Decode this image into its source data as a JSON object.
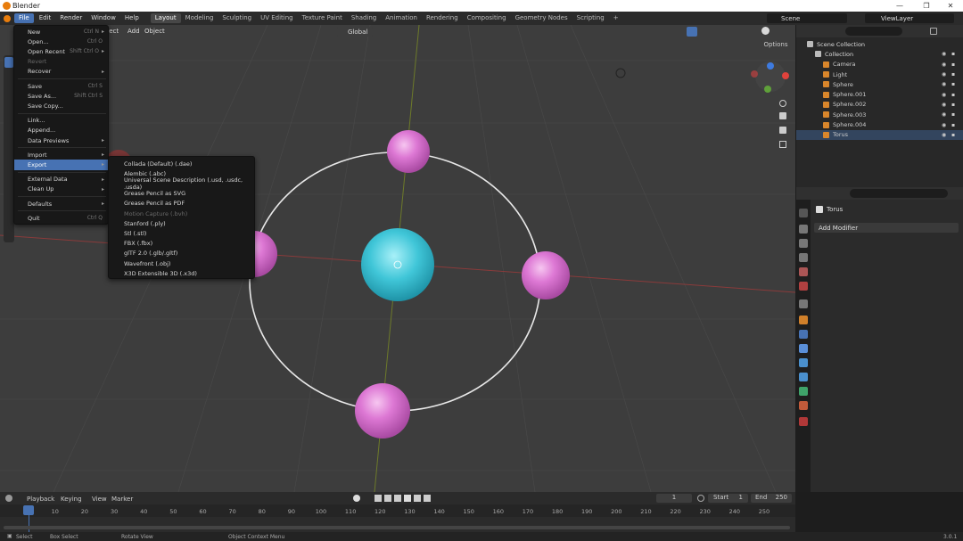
{
  "window": {
    "title": "Blender",
    "controls": [
      "—",
      "❐",
      "✕"
    ]
  },
  "menubar": {
    "items": [
      "File",
      "Edit",
      "Render",
      "Window",
      "Help"
    ],
    "workspaces": [
      "Layout",
      "Modeling",
      "Sculpting",
      "UV Editing",
      "Texture Paint",
      "Shading",
      "Animation",
      "Rendering",
      "Compositing",
      "Geometry Nodes",
      "Scripting"
    ],
    "add_ws": "+",
    "scene": "Scene",
    "view_layer": "ViewLayer"
  },
  "viewport": {
    "header_partial": "elect",
    "add": "Add",
    "object": "Object",
    "orientation": "Global",
    "options": "Options"
  },
  "file_menu": [
    {
      "label": "New",
      "shortcut": "Ctrl N",
      "arrow": true
    },
    {
      "label": "Open...",
      "shortcut": "Ctrl O"
    },
    {
      "label": "Open Recent",
      "shortcut": "Shift Ctrl O",
      "arrow": true
    },
    {
      "label": "Revert",
      "disabled": true
    },
    {
      "label": "Recover",
      "arrow": true
    },
    {
      "sep": true
    },
    {
      "label": "Save",
      "shortcut": "Ctrl S"
    },
    {
      "label": "Save As...",
      "shortcut": "Shift Ctrl S"
    },
    {
      "label": "Save Copy..."
    },
    {
      "sep": true
    },
    {
      "label": "Link..."
    },
    {
      "label": "Append..."
    },
    {
      "label": "Data Previews",
      "arrow": true
    },
    {
      "sep": true
    },
    {
      "label": "Import",
      "arrow": true
    },
    {
      "label": "Export",
      "arrow": true,
      "highlight": true
    },
    {
      "sep": true
    },
    {
      "label": "External Data",
      "arrow": true
    },
    {
      "label": "Clean Up",
      "arrow": true
    },
    {
      "sep": true
    },
    {
      "label": "Defaults",
      "arrow": true
    },
    {
      "sep": true
    },
    {
      "label": "Quit",
      "shortcut": "Ctrl Q"
    }
  ],
  "export_menu": [
    {
      "label": "Collada (Default) (.dae)"
    },
    {
      "label": "Alembic (.abc)"
    },
    {
      "label": "Universal Scene Description (.usd, .usdc, .usda)"
    },
    {
      "label": "Grease Pencil as SVG"
    },
    {
      "label": "Grease Pencil as PDF"
    },
    {
      "label": "Motion Capture (.bvh)",
      "disabled": true
    },
    {
      "label": "Stanford (.ply)"
    },
    {
      "label": "Stl (.stl)"
    },
    {
      "label": "FBX (.fbx)"
    },
    {
      "label": "glTF 2.0 (.glb/.gltf)"
    },
    {
      "label": "Wavefront (.obj)"
    },
    {
      "label": "X3D Extensible 3D (.x3d)"
    }
  ],
  "outliner": {
    "rows": [
      {
        "label": "Scene Collection",
        "indent": 0,
        "color": "#ddd"
      },
      {
        "label": "Collection",
        "indent": 1,
        "color": "#ddd"
      },
      {
        "label": "Camera",
        "indent": 2,
        "color": "#ccc"
      },
      {
        "label": "Light",
        "indent": 2,
        "color": "#ccc"
      },
      {
        "label": "Sphere",
        "indent": 2,
        "color": "#ccc"
      },
      {
        "label": "Sphere.001",
        "indent": 2,
        "color": "#ccc"
      },
      {
        "label": "Sphere.002",
        "indent": 2,
        "color": "#ccc"
      },
      {
        "label": "Sphere.003",
        "indent": 2,
        "color": "#ccc"
      },
      {
        "label": "Sphere.004",
        "indent": 2,
        "color": "#ccc"
      },
      {
        "label": "Torus",
        "indent": 2,
        "color": "#ccc",
        "selected": true
      }
    ]
  },
  "properties": {
    "object": "Torus",
    "add_modifier": "Add Modifier"
  },
  "timeline": {
    "menus": [
      "Playback",
      "Keying",
      "View",
      "Marker"
    ],
    "current": "1",
    "start_label": "Start",
    "start": "1",
    "end_label": "End",
    "end": "250",
    "ticks": [
      "1",
      "10",
      "20",
      "30",
      "40",
      "50",
      "60",
      "70",
      "80",
      "90",
      "100",
      "110",
      "120",
      "130",
      "140",
      "150",
      "160",
      "170",
      "180",
      "190",
      "200",
      "210",
      "220",
      "230",
      "240",
      "250"
    ]
  },
  "status": {
    "select": "Select",
    "box": "Box Select",
    "rotate": "Rotate View",
    "context": "Object Context Menu",
    "version": "3.0.1"
  },
  "colors": {
    "accent": "#4772b3",
    "sphere": "#d96fd0",
    "center": "#3fc4d6"
  }
}
